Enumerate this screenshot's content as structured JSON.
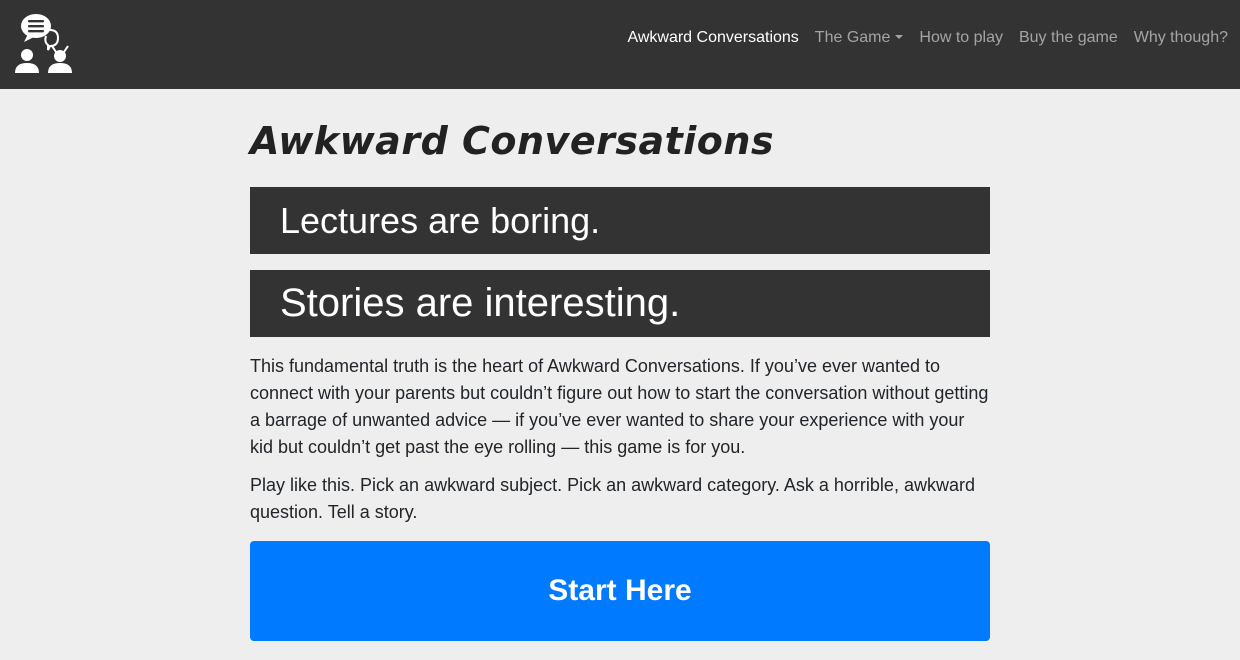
{
  "brand": {
    "logo_icon": "chat-people-logo-icon"
  },
  "nav": {
    "items": [
      {
        "label": "Awkward Conversations"
      },
      {
        "label": "The Game"
      },
      {
        "label": "How to play"
      },
      {
        "label": "Buy the game"
      },
      {
        "label": "Why though?"
      }
    ]
  },
  "main": {
    "title": "Awkward Conversations",
    "banner_1": "Lectures are boring.",
    "banner_2": "Stories are interesting.",
    "paragraph_1": "This fundamental truth is the heart of Awkward Conversations. If you’ve ever wanted to connect with your parents but couldn’t figure out how to start the conversation without getting a barrage of unwanted advice — if you’ve ever wanted to share your experience with your kid but couldn’t get past the eye rolling — this game is for you.",
    "paragraph_2": "Play like this. Pick an awkward subject. Pick an awkward category. Ask a horrible, awkward question. Tell a story.",
    "cta_label": "Start Here"
  },
  "colors": {
    "navbar_bg": "#333333",
    "page_bg": "#eeeeee",
    "banner_bg": "#333333",
    "cta_bg": "#007bff"
  }
}
